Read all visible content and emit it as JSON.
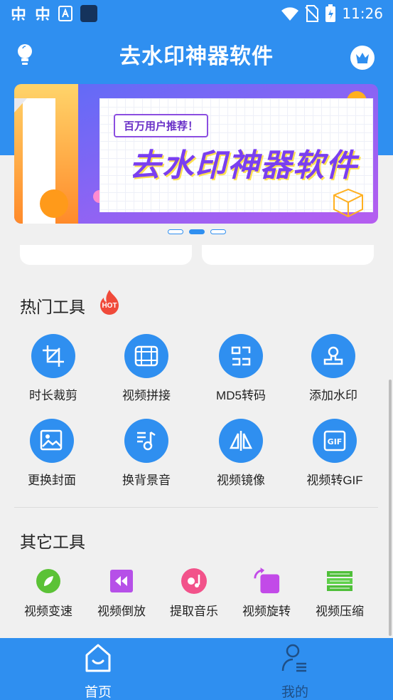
{
  "status_bar": {
    "time": "11:26"
  },
  "header": {
    "title": "去水印神器软件"
  },
  "banner": {
    "tag": "百万用户推荐！",
    "headline": "去水印神器软件"
  },
  "hot_tools": {
    "title": "热门工具",
    "badge": "HOT",
    "items": [
      {
        "label": "时长裁剪",
        "icon": "crop-icon"
      },
      {
        "label": "视频拼接",
        "icon": "film-icon"
      },
      {
        "label": "MD5转码",
        "icon": "md5-icon"
      },
      {
        "label": "添加水印",
        "icon": "stamp-icon"
      },
      {
        "label": "更换封面",
        "icon": "image-icon"
      },
      {
        "label": "换背景音",
        "icon": "music-note-icon"
      },
      {
        "label": "视频镜像",
        "icon": "mirror-icon"
      },
      {
        "label": "视频转GIF",
        "icon": "gif-icon"
      }
    ]
  },
  "other_tools": {
    "title": "其它工具",
    "items": [
      {
        "label": "视频变速",
        "icon": "speed-icon"
      },
      {
        "label": "视频倒放",
        "icon": "rewind-icon"
      },
      {
        "label": "提取音乐",
        "icon": "music-disc-icon"
      },
      {
        "label": "视频旋转",
        "icon": "rotate-icon"
      },
      {
        "label": "视频压缩",
        "icon": "compress-icon"
      }
    ]
  },
  "bottom_nav": {
    "items": [
      {
        "label": "首页",
        "icon": "home-icon",
        "active": true
      },
      {
        "label": "我的",
        "icon": "profile-icon",
        "active": false
      }
    ]
  },
  "colors": {
    "primary": "#2f8ff0",
    "purple": "#7a3ff0",
    "orange": "#f5a623"
  }
}
